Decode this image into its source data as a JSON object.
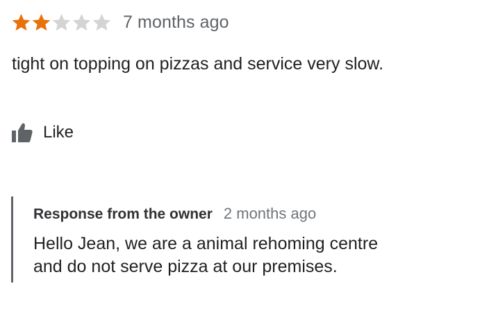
{
  "review": {
    "rating": 2,
    "rating_max": 5,
    "time_ago": "7 months ago",
    "text": "tight on topping on pizzas and service very slow.",
    "like_label": "Like",
    "icons": {
      "filled_star": "star-filled-icon",
      "empty_star": "star-empty-icon",
      "like": "thumbs-up-icon"
    }
  },
  "owner_response": {
    "title": "Response from the owner",
    "time_ago": "2 months ago",
    "body_line1": "Hello Jean, we are a animal rehoming centre",
    "body_line2": "and do not serve pizza at our premises."
  },
  "colors": {
    "star_filled": "#e8710a",
    "star_empty": "#d4d4d4",
    "secondary_text": "#5f6368",
    "response_bar": "#5f6368"
  }
}
